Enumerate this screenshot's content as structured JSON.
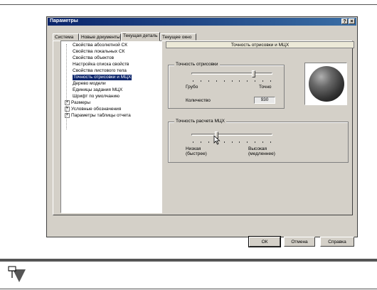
{
  "window": {
    "title": "Параметры",
    "help_btn": "?",
    "close_btn": "×"
  },
  "tabs": [
    {
      "label": "Система"
    },
    {
      "label": "Новые документы"
    },
    {
      "label": "Текущая деталь",
      "active": true
    },
    {
      "label": "Текущее окно"
    }
  ],
  "tree": {
    "items": [
      {
        "label": "Свойства абсолютной СК"
      },
      {
        "label": "Свойства локальных СК"
      },
      {
        "label": "Свойства объектов"
      },
      {
        "label": "Настройка списка свойств"
      },
      {
        "label": "Свойства листового тела"
      },
      {
        "label": "Точность отрисовки и МЦХ",
        "selected": true
      },
      {
        "label": "Дерево модели"
      },
      {
        "label": "Единицы задания МЦХ"
      },
      {
        "label": "Шрифт по умолчанию"
      },
      {
        "label": "Размеры",
        "expander": "+"
      },
      {
        "label": "Условные обозначения",
        "expander": "+"
      },
      {
        "label": "Параметры таблицы отчета",
        "expander": "+"
      }
    ]
  },
  "right_panel": {
    "header": "Точность отрисовки и МЦХ",
    "draw_precision": {
      "title": "Точность отрисовки",
      "min_label": "Грубо",
      "max_label": "Точно",
      "slider_level": 0.78,
      "count_label": "Количество",
      "count_value": "930"
    },
    "mcx_precision": {
      "title": "Точность расчета МЦХ",
      "min_label_line1": "Низкая",
      "min_label_line2": "(быстрее)",
      "max_label_line1": "Высокая",
      "max_label_line2": "(медленнее)",
      "slider_level": 0.3
    }
  },
  "buttons": {
    "ok": "ОК",
    "cancel": "Отмена",
    "help": "Справка"
  }
}
